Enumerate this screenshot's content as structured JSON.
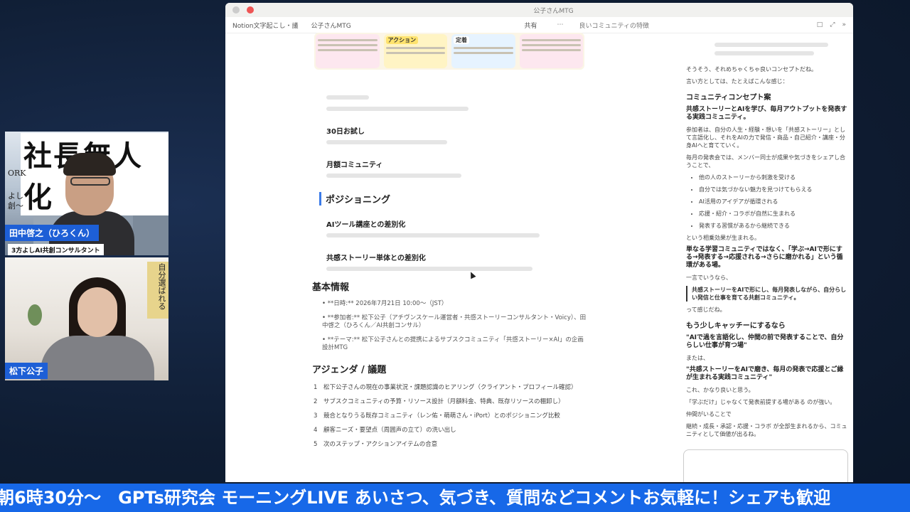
{
  "participants": [
    {
      "name": "田中啓之（ひろくん）",
      "subtitle": "3方よしAI共創コンサルタント",
      "background_text": "社長無人化",
      "side_text": [
        "ORK",
        "よし",
        "創〜"
      ]
    },
    {
      "name": "松下公子",
      "book_text": "自分選ばれる"
    }
  ],
  "window": {
    "title": "公子さんMTG",
    "breadcrumbs": [
      "Notion文字起こし・議",
      "公子さんMTG"
    ],
    "share_label": "共有",
    "chat_title": "良いコミュニティの特徴"
  },
  "mindmap": {
    "labels": [
      "アクション",
      "定着"
    ]
  },
  "doc": {
    "items": [
      {
        "title": "30日お試し"
      },
      {
        "title": "月額コミュニティ"
      }
    ],
    "positioning": {
      "title": "ポジショニング",
      "items": [
        {
          "title": "AIツール講座との差別化"
        },
        {
          "title": "共感ストーリー単体との差別化"
        }
      ]
    },
    "basic_info": {
      "title": "基本情報",
      "bullets": [
        "**日時:** 2026年7月21日 10:00〜（JST）",
        "**参加者:** 松下公子（アチヴンスケール運営者・共感ストーリーコンサルタント・Voicy）、田中啓之（ひろくん／AI共創コンサル）",
        "**テーマ:** 松下公子さんとの提携によるサブスクコミュニティ「共感ストーリー×AI」の企画設計MTG"
      ]
    },
    "agenda": {
      "title": "アジェンダ / 議題",
      "items": [
        "松下公子さんの現在の事業状況・課題認識のヒアリング（クライアント・プロフィール確認）",
        "サブスクコミュニティの予算・リソース設計（月額料金、特典、既存リソースの棚卸し）",
        "競合となりうる既存コミュニティ（レン佑・萌萌さん・iPort）とのポジショニング比較",
        "顧客ニーズ・要望点（周囲声の立て）の洗い出し",
        "次のステップ・アクションアイテムの合意"
      ]
    }
  },
  "chat": {
    "intro": "そうそう、それめちゃくちゃ良いコンセプトだね。",
    "intro2": "言い方としては、たとえばこんな感じ：",
    "concept_heading": "コミュニティコンセプト案",
    "concept_lead": "共感ストーリーとAIを学び、毎月アウトプットを発表する実践コミュニティ。",
    "concept_body": "参加者は、自分の人生・経験・想いを「共感ストーリー」として言語化し、それをAIの力で発信・商品・自己紹介・講座・分身AIへと育てていく。",
    "concept_body2": "毎月の発表会では、メンバー同士が成果や気づきをシェアし合うことで、",
    "bullets": [
      "他の人のストーリーから刺激を受ける",
      "自分では気づかない魅力を見つけてもらえる",
      "AI活用のアイデアが循環される",
      "応援・紹介・コラボが自然に生まれる",
      "発表する習慣があるから継続できる"
    ],
    "after": "という相乗効果が生まれる。",
    "summary": "単なる学習コミュニティではなく、「学ぶ→AIで形にする→発表する→応援される→さらに磨かれる」という循環がある場。",
    "one_line_label": "一言でいうなら、",
    "quote": "共感ストーリーをAIで形にし、毎月発表しながら、自分らしい発信と仕事を育てる共創コミュニティ。",
    "quote_after": "って感じだね。",
    "catchy_heading": "もう少しキャッチーにするなら",
    "catchy1": "\"AIで過を言語化し、仲間の前で発表することで、自分らしい仕事が育つ場\"",
    "or": "または、",
    "catchy2": "\"共感ストーリーをAIで磨き、毎月の発表で応援とご縁が生まれる実践コミュニティ\"",
    "comment": "これ、かなり良いと思う。",
    "comment2": "「学ぶだけ」じゃなくて発表前提する場がある のが強い。",
    "comment3": "仲間がいることで",
    "final": "継続・成長・承認・応援・コラボ が全部生まれるから、コミュニティとして価値が出るね。"
  },
  "ticker": {
    "text": "朝6時30分〜　GPTs研究会 モーニングLIVE あいさつ、気づき、質問などコメントお気軽に！シェアも歓迎"
  }
}
